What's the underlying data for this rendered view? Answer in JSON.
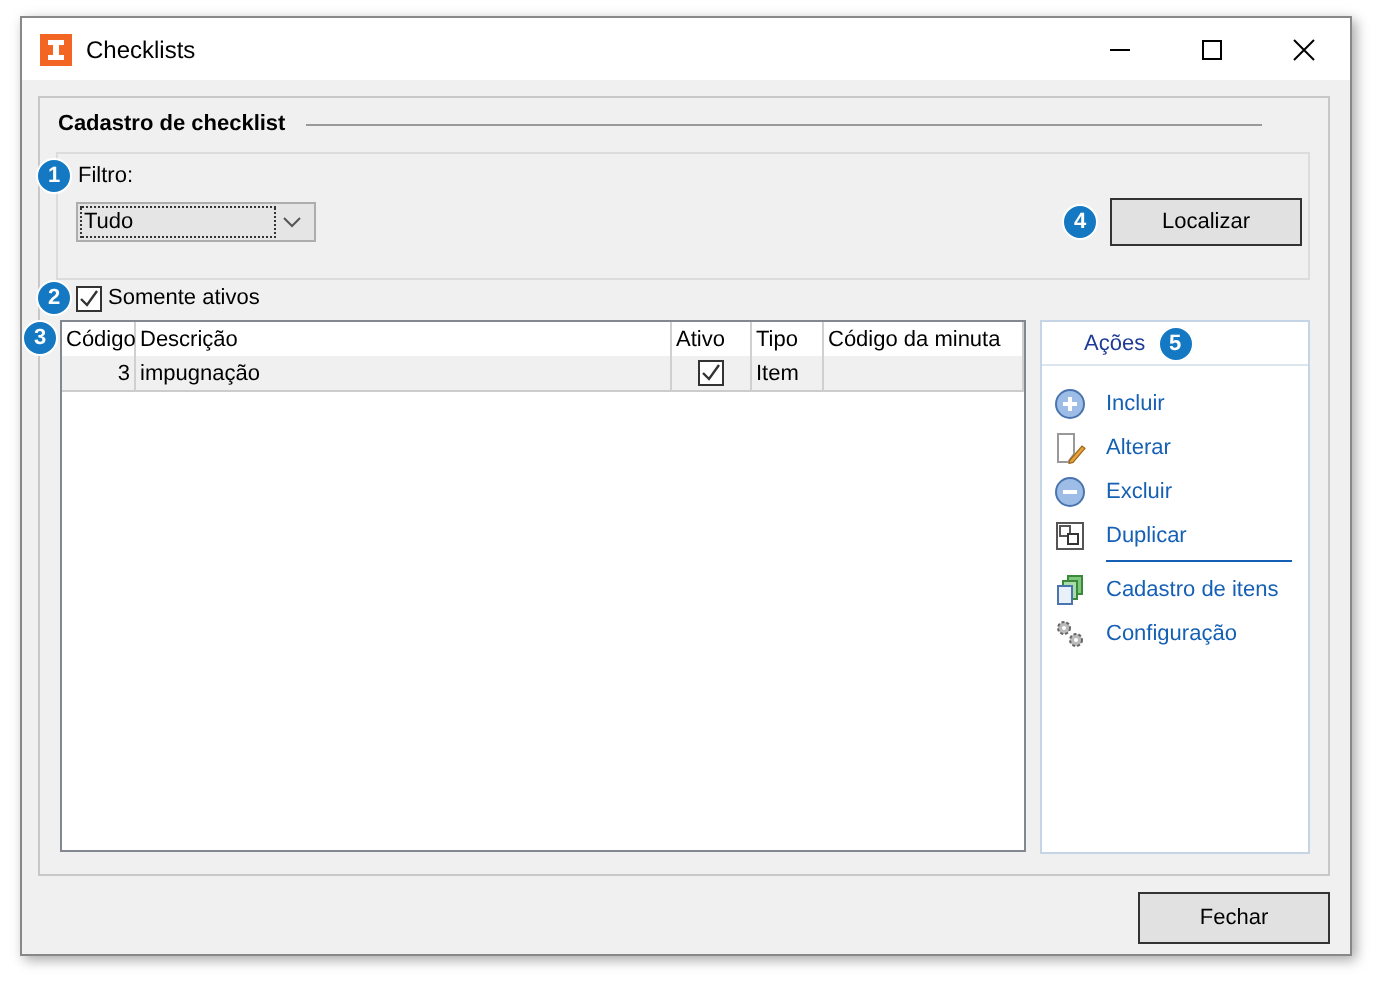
{
  "window": {
    "title": "Checklists"
  },
  "group_title": "Cadastro de checklist",
  "filter": {
    "marker": "1",
    "label": "Filtro:",
    "value": "Tudo"
  },
  "only_active": {
    "marker": "2",
    "label": "Somente ativos",
    "checked": true
  },
  "search_button": {
    "marker": "4",
    "label": "Localizar"
  },
  "table": {
    "marker": "3",
    "columns": [
      "Código",
      "Descrição",
      "Ativo",
      "Tipo",
      "Código da minuta"
    ],
    "rows": [
      {
        "code": "3",
        "description": "impugnação",
        "active": true,
        "type": "Item",
        "minute_code": ""
      }
    ]
  },
  "actions_panel": {
    "title": "Ações",
    "marker": "5",
    "actions": [
      {
        "label": "Incluir"
      },
      {
        "label": "Alterar"
      },
      {
        "label": "Excluir"
      },
      {
        "label": "Duplicar"
      }
    ],
    "more_actions": [
      {
        "label": "Cadastro de itens"
      },
      {
        "label": "Configuração"
      }
    ]
  },
  "close_button": "Fechar"
}
